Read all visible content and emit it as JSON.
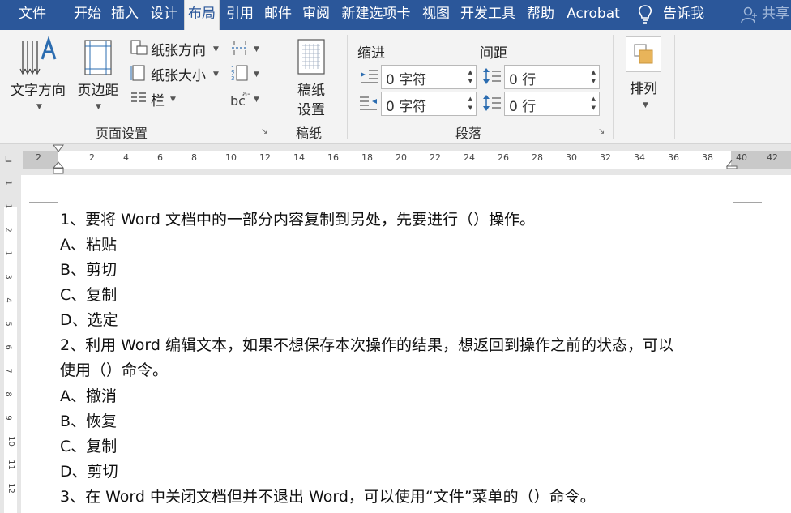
{
  "tabs": [
    {
      "label": "文件",
      "active": false
    },
    {
      "label": "开始",
      "active": false
    },
    {
      "label": "插入",
      "active": false
    },
    {
      "label": "设计",
      "active": false
    },
    {
      "label": "布局",
      "active": true
    },
    {
      "label": "引用",
      "active": false
    },
    {
      "label": "邮件",
      "active": false
    },
    {
      "label": "审阅",
      "active": false
    },
    {
      "label": "新建选项卡",
      "active": false
    },
    {
      "label": "视图",
      "active": false
    },
    {
      "label": "开发工具",
      "active": false
    },
    {
      "label": "帮助",
      "active": false
    },
    {
      "label": "Acrobat",
      "active": false
    }
  ],
  "tell_me": "告诉我",
  "share": "共享",
  "ribbon": {
    "page_setup": {
      "text_direction": "文字方向",
      "margins": "页边距",
      "orientation": "纸张方向",
      "size": "纸张大小",
      "columns": "栏",
      "group_label": "页面设置"
    },
    "draft": {
      "setup_line1": "稿纸",
      "setup_line2": "设置",
      "group_label": "稿纸"
    },
    "paragraph": {
      "indent_title": "缩进",
      "spacing_title": "间距",
      "indent_left": "0 字符",
      "indent_right": "0 字符",
      "spacing_before": "0 行",
      "spacing_after": "0 行",
      "group_label": "段落"
    },
    "arrange": {
      "label": "排列"
    }
  },
  "ruler_numbers": [
    "2",
    "2",
    "4",
    "6",
    "8",
    "10",
    "12",
    "14",
    "16",
    "18",
    "20",
    "22",
    "24",
    "26",
    "28",
    "30",
    "32",
    "34",
    "36",
    "38",
    "40",
    "42"
  ],
  "vruler_numbers": [
    "1",
    "1",
    "2",
    "1",
    "3",
    "4",
    "5",
    "6",
    "7",
    "8",
    "9",
    "10",
    "11",
    "12"
  ],
  "document": {
    "lines": [
      "1、要将 Word 文档中的一部分内容复制到另处，先要进行（）操作。",
      "A、粘贴",
      "B、剪切",
      "C、复制",
      "D、选定",
      "2、利用 Word 编辑文本，如果不想保存本次操作的结果，想返回到操作之前的状态，可以",
      "使用（）命令。",
      "A、撤消",
      "B、恢复",
      "C、复制",
      "D、剪切",
      "3、在 Word  中关闭文档但并不退出 Word，可以使用“文件”菜单的（）命令。"
    ]
  },
  "colors": {
    "tab_bar": "#2b579a",
    "ribbon_bg": "#f3f3f3",
    "icon_blue": "#2b6cb0",
    "arrange_fill": "#e8b45a"
  }
}
